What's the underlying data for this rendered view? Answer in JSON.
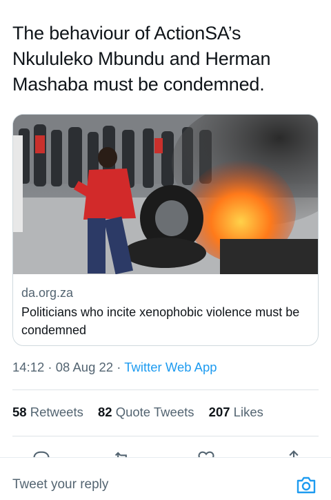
{
  "tweet": {
    "text": "The behaviour of ActionSA’s Nkululeko Mbundu and Herman Mashaba must be condemned."
  },
  "card": {
    "domain": "da.org.za",
    "title": "Politicians who incite xenophobic violence must be condemned"
  },
  "meta": {
    "time": "14:12",
    "separator": " · ",
    "date": "08 Aug 22",
    "app": "Twitter Web App"
  },
  "stats": {
    "retweets_count": "58",
    "retweets_label": "Retweets",
    "quotes_count": "82",
    "quotes_label": "Quote Tweets",
    "likes_count": "207",
    "likes_label": "Likes"
  },
  "actions": {
    "icons": [
      "reply-icon",
      "retweet-icon",
      "like-icon",
      "share-icon"
    ]
  },
  "reply": {
    "placeholder": "Tweet your reply",
    "icon": "camera-icon"
  },
  "colors": {
    "accent": "#1d9bf0",
    "text": "#0f1419",
    "secondary": "#536471",
    "border": "#cfd9de"
  }
}
